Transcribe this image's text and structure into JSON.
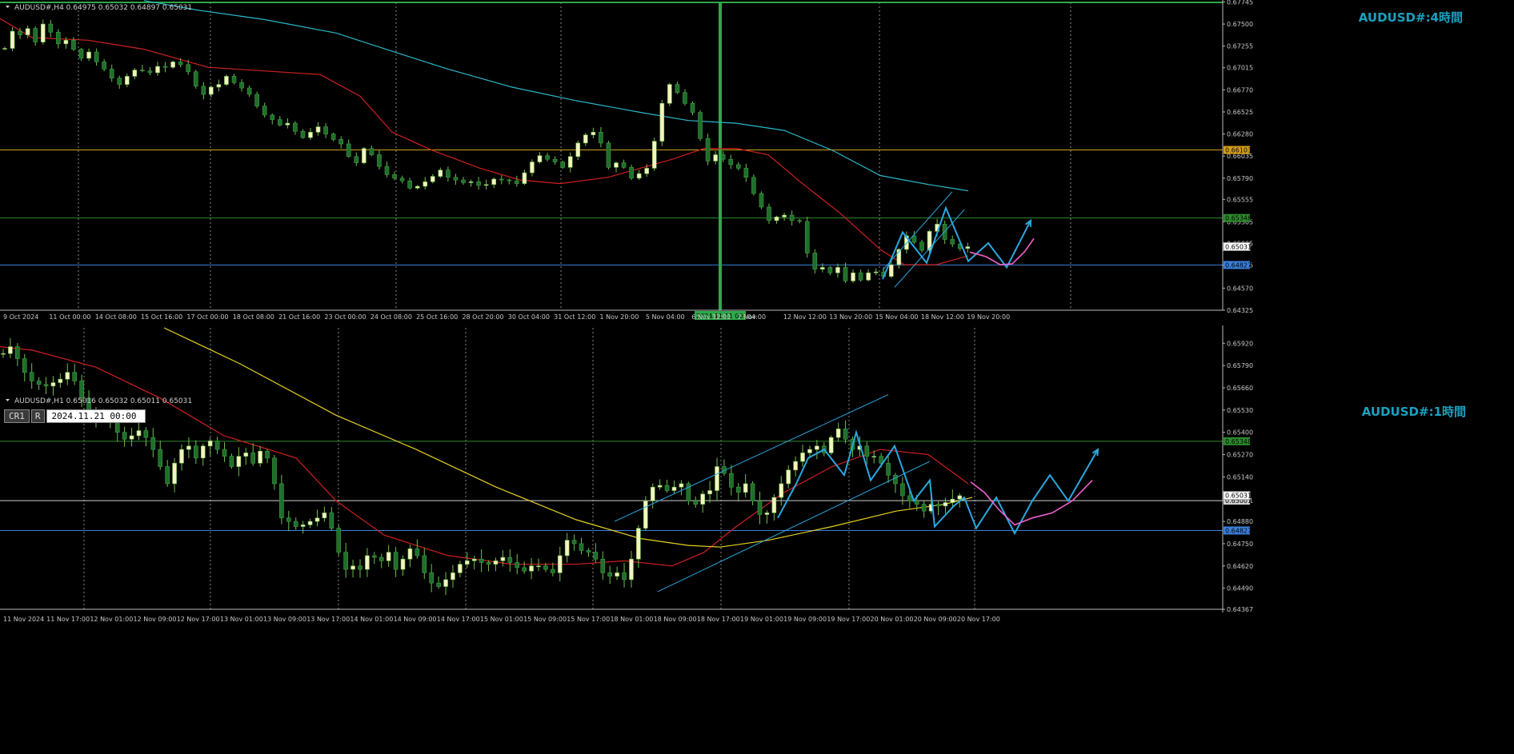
{
  "chart_data": [
    {
      "type": "candlestick",
      "symbol_info": "AUDUSD#,H4  0.64975 0.65032 0.64897 0.65031",
      "watermark": "AUDUSD#:4時間",
      "ylim": [
        0.64325,
        0.6774
      ],
      "yticks": [
        "0.67745",
        "0.67500",
        "0.67255",
        "0.67015",
        "0.66770",
        "0.66525",
        "0.66280",
        "0.66035",
        "0.65790",
        "0.65555",
        "0.65305",
        "0.65065",
        "0.64825",
        "0.64570",
        "0.64325"
      ],
      "xticks": [
        "9 Oct 2024",
        "11 Oct 00:00",
        "14 Oct 08:00",
        "15 Oct 16:00",
        "17 Oct 00:00",
        "18 Oct 08:00",
        "21 Oct 16:00",
        "23 Oct 00:00",
        "24 Oct 08:00",
        "25 Oct 16:00",
        "28 Oct 20:00",
        "30 Oct 04:00",
        "31 Oct 12:00",
        "1 Nov 20:00",
        "5 Nov 04:00",
        "6 Nov 12:00",
        "7 Nov",
        "12 Nov 12:00",
        "13 Nov 20:00",
        "15 Nov 04:00",
        "18 Nov 12:00",
        "19 Nov 20:00"
      ],
      "cursor_label": "2024.11.11 00:00",
      "cursor_tail": "04:00",
      "hlines": [
        {
          "value": 0.66103,
          "label": "0.66103",
          "color": "#d4a017"
        },
        {
          "value": 0.65348,
          "label": "0.65348",
          "color": "#2e8b2e"
        },
        {
          "value": 0.64827,
          "label": "0.64827",
          "color": "#3b7fd9"
        }
      ],
      "current_price": "0.65031",
      "close_path": [
        0.6723,
        0.6742,
        0.6738,
        0.6745,
        0.673,
        0.675,
        0.6741,
        0.6728,
        0.6732,
        0.6722,
        0.6712,
        0.6719,
        0.6708,
        0.67,
        0.669,
        0.6683,
        0.6692,
        0.6699,
        0.6698,
        0.6696,
        0.6703,
        0.6702,
        0.6708,
        0.6705,
        0.6697,
        0.6681,
        0.6672,
        0.668,
        0.6683,
        0.6692,
        0.6685,
        0.6679,
        0.6672,
        0.6659,
        0.6649,
        0.6644,
        0.6638,
        0.664,
        0.6631,
        0.6624,
        0.663,
        0.6636,
        0.6628,
        0.6622,
        0.6617,
        0.6603,
        0.6596,
        0.6612,
        0.6605,
        0.6592,
        0.6583,
        0.6579,
        0.6576,
        0.6568,
        0.657,
        0.6575,
        0.6581,
        0.6588,
        0.658,
        0.6577,
        0.6574,
        0.6575,
        0.6571,
        0.6572,
        0.6578,
        0.6577,
        0.6576,
        0.6573,
        0.6585,
        0.6597,
        0.6604,
        0.66,
        0.6597,
        0.6591,
        0.6603,
        0.6618,
        0.6627,
        0.663,
        0.6618,
        0.6591,
        0.6596,
        0.6591,
        0.6579,
        0.6584,
        0.659,
        0.662,
        0.6662,
        0.6683,
        0.6674,
        0.6662,
        0.6652,
        0.6623,
        0.6598,
        0.6605,
        0.66,
        0.6594,
        0.659,
        0.658,
        0.6562,
        0.6547,
        0.6532,
        0.6536,
        0.6538,
        0.6532,
        0.6531,
        0.6496,
        0.6478,
        0.648,
        0.6474,
        0.648,
        0.6465,
        0.6474,
        0.6466,
        0.6474,
        0.6475,
        0.647,
        0.6483,
        0.65,
        0.6515,
        0.6508,
        0.6499,
        0.652,
        0.6528,
        0.6511,
        0.6506,
        0.6501,
        0.6503
      ],
      "ma_fast": [
        [
          0,
          0.6756
        ],
        [
          40,
          0.6735
        ],
        [
          110,
          0.6732
        ],
        [
          180,
          0.6722
        ],
        [
          260,
          0.6702
        ],
        [
          330,
          0.6698
        ],
        [
          400,
          0.6694
        ],
        [
          450,
          0.667
        ],
        [
          490,
          0.663
        ],
        [
          540,
          0.661
        ],
        [
          600,
          0.659
        ],
        [
          650,
          0.6577
        ],
        [
          700,
          0.6573
        ],
        [
          760,
          0.658
        ],
        [
          800,
          0.659
        ],
        [
          840,
          0.66
        ],
        [
          880,
          0.6612
        ],
        [
          920,
          0.6612
        ],
        [
          960,
          0.6605
        ],
        [
          1000,
          0.6575
        ],
        [
          1050,
          0.654
        ],
        [
          1100,
          0.65
        ],
        [
          1130,
          0.6483
        ],
        [
          1170,
          0.6483
        ],
        [
          1210,
          0.6493
        ]
      ],
      "ma_slow": [
        [
          180,
          0.6776
        ],
        [
          250,
          0.6765
        ],
        [
          330,
          0.6755
        ],
        [
          420,
          0.674
        ],
        [
          500,
          0.6717
        ],
        [
          560,
          0.67
        ],
        [
          640,
          0.668
        ],
        [
          720,
          0.6665
        ],
        [
          800,
          0.6652
        ],
        [
          860,
          0.6643
        ],
        [
          920,
          0.664
        ],
        [
          980,
          0.6632
        ],
        [
          1040,
          0.661
        ],
        [
          1100,
          0.6582
        ],
        [
          1160,
          0.6572
        ],
        [
          1210,
          0.6565
        ]
      ],
      "channel": [
        [
          [
            1103,
            0.6477
          ],
          [
            1190,
            0.6564
          ]
        ],
        [
          [
            1118,
            0.6458
          ],
          [
            1205,
            0.6544
          ]
        ]
      ],
      "zigzag": [
        [
          1103,
          0.6467
        ],
        [
          1128,
          0.6519
        ],
        [
          1158,
          0.6485
        ],
        [
          1182,
          0.6546
        ],
        [
          1210,
          0.6487
        ],
        [
          1235,
          0.6507
        ],
        [
          1258,
          0.648
        ],
        [
          1288,
          0.6532
        ]
      ],
      "projection": [
        [
          1212,
          0.6497
        ],
        [
          1232,
          0.6492
        ],
        [
          1250,
          0.6483
        ],
        [
          1265,
          0.6484
        ],
        [
          1280,
          0.6497
        ],
        [
          1292,
          0.6512
        ]
      ]
    },
    {
      "type": "candlestick",
      "symbol_info": "AUDUSD#,H1  0.65016 0.65032 0.65011 0.65031",
      "watermark": "AUDUSD#:1時間",
      "toolbar": {
        "cr": "CR1",
        "r": "R",
        "date": "2024.11.21 00:00"
      },
      "ylim": [
        0.64367,
        0.6601
      ],
      "yticks": [
        "0.65920",
        "0.65790",
        "0.65660",
        "0.65530",
        "0.65400",
        "0.65270",
        "0.65140",
        "0.65001",
        "0.64880",
        "0.64750",
        "0.64620",
        "0.64490",
        "0.64367"
      ],
      "xticks": [
        "11 Nov 2024",
        "11 Nov 17:00",
        "12 Nov 01:00",
        "12 Nov 09:00",
        "12 Nov 17:00",
        "13 Nov 01:00",
        "13 Nov 09:00",
        "13 Nov 17:00",
        "14 Nov 01:00",
        "14 Nov 09:00",
        "14 Nov 17:00",
        "15 Nov 01:00",
        "15 Nov 09:00",
        "15 Nov 17:00",
        "18 Nov 01:00",
        "18 Nov 09:00",
        "18 Nov 17:00",
        "19 Nov 01:00",
        "19 Nov 09:00",
        "19 Nov 17:00",
        "20 Nov 01:00",
        "20 Nov 09:00",
        "20 Nov 17:00"
      ],
      "hlines": [
        {
          "value": 0.65348,
          "label": "0.65348",
          "color": "#2e8b2e"
        },
        {
          "value": 0.65001,
          "label": "0.65001",
          "color": "#d0d0d0"
        },
        {
          "value": 0.64827,
          "label": "0.64827",
          "color": "#3b7fd9"
        }
      ],
      "current_price": "0.65031",
      "close_path": [
        0.6586,
        0.659,
        0.6583,
        0.6575,
        0.657,
        0.6568,
        0.6567,
        0.6569,
        0.6571,
        0.6575,
        0.657,
        0.656,
        0.6552,
        0.6548,
        0.6549,
        0.6546,
        0.654,
        0.6536,
        0.6538,
        0.6541,
        0.6537,
        0.653,
        0.652,
        0.651,
        0.6522,
        0.653,
        0.6532,
        0.6525,
        0.6532,
        0.6535,
        0.653,
        0.6526,
        0.652,
        0.6526,
        0.6528,
        0.6522,
        0.6529,
        0.6525,
        0.651,
        0.649,
        0.6488,
        0.6485,
        0.6486,
        0.6488,
        0.649,
        0.6493,
        0.6484,
        0.647,
        0.646,
        0.6462,
        0.646,
        0.6468,
        0.6467,
        0.6465,
        0.647,
        0.646,
        0.6466,
        0.6472,
        0.6468,
        0.6458,
        0.6452,
        0.645,
        0.6454,
        0.6458,
        0.6463,
        0.6465,
        0.6466,
        0.6464,
        0.6463,
        0.6465,
        0.6467,
        0.6464,
        0.6461,
        0.6459,
        0.6462,
        0.6462,
        0.646,
        0.6458,
        0.6468,
        0.6477,
        0.6475,
        0.6471,
        0.647,
        0.6466,
        0.6458,
        0.6456,
        0.6458,
        0.6454,
        0.6466,
        0.6484,
        0.65,
        0.6508,
        0.6509,
        0.6506,
        0.6508,
        0.651,
        0.65,
        0.6498,
        0.6504,
        0.6506,
        0.652,
        0.6516,
        0.6508,
        0.6505,
        0.651,
        0.65,
        0.6492,
        0.6493,
        0.6502,
        0.651,
        0.6518,
        0.6523,
        0.6528,
        0.653,
        0.6532,
        0.6528,
        0.6537,
        0.6542,
        0.6536,
        0.653,
        0.6532,
        0.6526,
        0.6526,
        0.6522,
        0.6515,
        0.651,
        0.6503,
        0.65,
        0.6498,
        0.6494,
        0.6498,
        0.6497,
        0.6499,
        0.6501,
        0.6503
      ],
      "ma_fast": [
        [
          0,
          0.659
        ],
        [
          40,
          0.6588
        ],
        [
          120,
          0.6578
        ],
        [
          200,
          0.656
        ],
        [
          280,
          0.6538
        ],
        [
          370,
          0.6525
        ],
        [
          420,
          0.65
        ],
        [
          480,
          0.648
        ],
        [
          560,
          0.6468
        ],
        [
          640,
          0.6463
        ],
        [
          720,
          0.6463
        ],
        [
          780,
          0.6465
        ],
        [
          840,
          0.6462
        ],
        [
          880,
          0.647
        ],
        [
          920,
          0.6485
        ],
        [
          980,
          0.6505
        ],
        [
          1040,
          0.652
        ],
        [
          1100,
          0.653
        ],
        [
          1160,
          0.6527
        ],
        [
          1210,
          0.651
        ]
      ],
      "ma_slow": [
        [
          205,
          0.6601
        ],
        [
          300,
          0.658
        ],
        [
          420,
          0.655
        ],
        [
          520,
          0.653
        ],
        [
          620,
          0.6508
        ],
        [
          720,
          0.6489
        ],
        [
          800,
          0.6478
        ],
        [
          860,
          0.6474
        ],
        [
          900,
          0.6473
        ],
        [
          960,
          0.6477
        ],
        [
          1040,
          0.6485
        ],
        [
          1120,
          0.6494
        ],
        [
          1180,
          0.6498
        ],
        [
          1215,
          0.6502
        ]
      ],
      "channel": [
        [
          [
            768,
            0.6488
          ],
          [
            1110,
            0.6562
          ]
        ],
        [
          [
            822,
            0.6447
          ],
          [
            1162,
            0.6523
          ]
        ]
      ],
      "zigzag": [
        [
          972,
          0.649
        ],
        [
          995,
          0.651
        ],
        [
          1010,
          0.6525
        ],
        [
          1030,
          0.653
        ],
        [
          1055,
          0.6515
        ],
        [
          1070,
          0.654
        ],
        [
          1088,
          0.6512
        ],
        [
          1118,
          0.6532
        ],
        [
          1142,
          0.65
        ],
        [
          1162,
          0.6512
        ],
        [
          1168,
          0.6485
        ],
        [
          1192,
          0.6497
        ],
        [
          1205,
          0.6502
        ],
        [
          1220,
          0.6484
        ],
        [
          1245,
          0.6502
        ],
        [
          1268,
          0.6481
        ],
        [
          1290,
          0.65
        ],
        [
          1312,
          0.6515
        ],
        [
          1335,
          0.65
        ],
        [
          1372,
          0.653
        ]
      ],
      "projection": [
        [
          1213,
          0.6511
        ],
        [
          1230,
          0.6505
        ],
        [
          1248,
          0.6495
        ],
        [
          1268,
          0.6486
        ],
        [
          1290,
          0.649
        ],
        [
          1315,
          0.6493
        ],
        [
          1340,
          0.65
        ],
        [
          1365,
          0.6512
        ]
      ]
    }
  ]
}
